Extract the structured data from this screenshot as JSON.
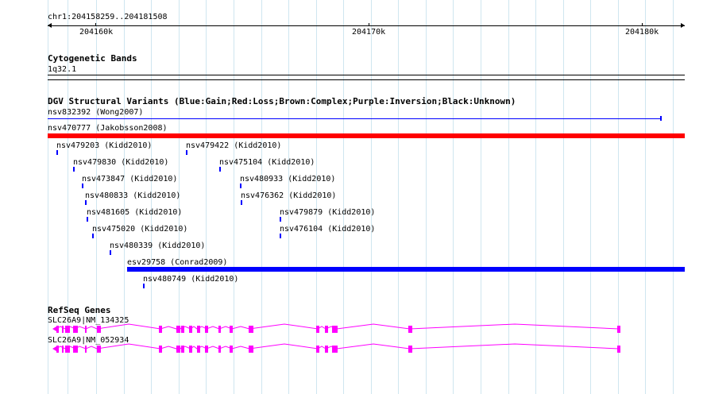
{
  "ruler": {
    "location": "chr1:204158259..204181508",
    "ticks": [
      "204160k",
      "204170k",
      "204180k"
    ]
  },
  "cytoband": {
    "title": "Cytogenetic Bands",
    "band": "1q32.1"
  },
  "dgv": {
    "title": "DGV Structural Variants (Blue:Gain;Red:Loss;Brown:Complex;Purple:Inversion;Black:Unknown)",
    "variants": [
      {
        "label": "nsv832392 (Wong2007)",
        "color": "#0000ff"
      },
      {
        "label": "nsv470777 (Jakobsson2008)",
        "color": "#ff0000"
      },
      {
        "label": "nsv479203 (Kidd2010)",
        "color": "#0000ff"
      },
      {
        "label": "nsv479422 (Kidd2010)",
        "color": "#0000ff"
      },
      {
        "label": "nsv479830 (Kidd2010)",
        "color": "#0000ff"
      },
      {
        "label": "nsv475104 (Kidd2010)",
        "color": "#0000ff"
      },
      {
        "label": "nsv473847 (Kidd2010)",
        "color": "#0000ff"
      },
      {
        "label": "nsv480933 (Kidd2010)",
        "color": "#0000ff"
      },
      {
        "label": "nsv480833 (Kidd2010)",
        "color": "#0000ff"
      },
      {
        "label": "nsv476362 (Kidd2010)",
        "color": "#0000ff"
      },
      {
        "label": "nsv481605 (Kidd2010)",
        "color": "#0000ff"
      },
      {
        "label": "nsv479879 (Kidd2010)",
        "color": "#0000ff"
      },
      {
        "label": "nsv475020 (Kidd2010)",
        "color": "#0000ff"
      },
      {
        "label": "nsv476104 (Kidd2010)",
        "color": "#0000ff"
      },
      {
        "label": "nsv480339 (Kidd2010)",
        "color": "#0000ff"
      },
      {
        "label": "esv29758 (Conrad2009)",
        "color": "#0000ff"
      },
      {
        "label": "nsv480749 (Kidd2010)",
        "color": "#0000ff"
      }
    ]
  },
  "refseq": {
    "title": "RefSeq Genes",
    "color": "#ff00ff",
    "genes": [
      {
        "label": "SLC26A9|NM_134325"
      },
      {
        "label": "SLC26A9|NM_052934"
      }
    ]
  }
}
